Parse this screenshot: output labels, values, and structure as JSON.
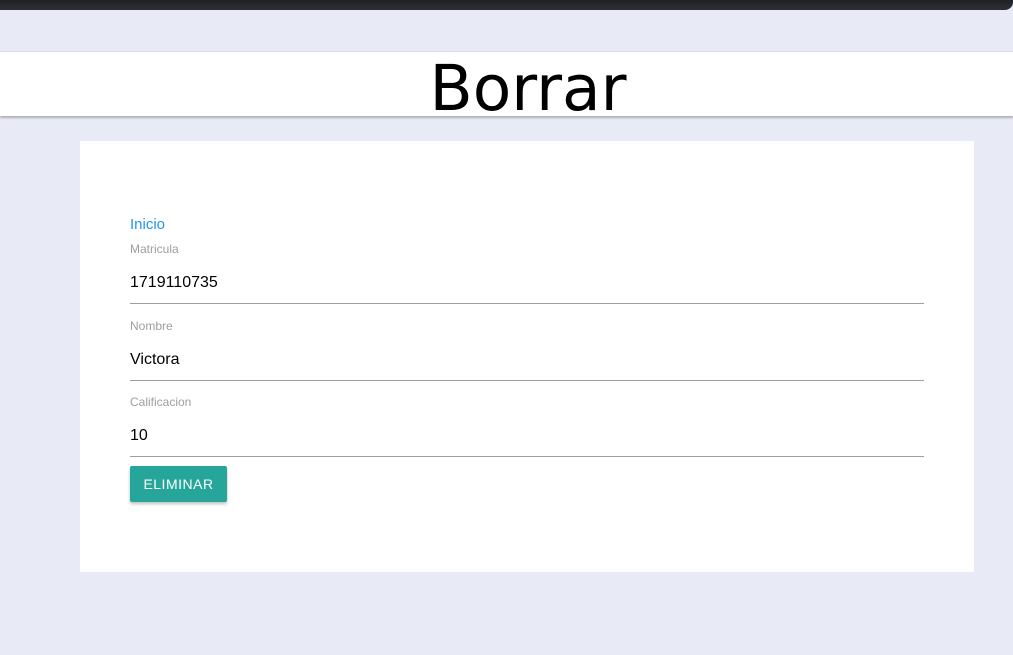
{
  "header": {
    "title": "Borrar"
  },
  "nav": {
    "inicio_label": "Inicio"
  },
  "form": {
    "fields": [
      {
        "label": "Matricula",
        "value": "1719110735"
      },
      {
        "label": "Nombre",
        "value": "Victora"
      },
      {
        "label": "Calificacion",
        "value": "10"
      }
    ],
    "submit_label": "ELIMINAR"
  },
  "colors": {
    "background": "#e8eaf6",
    "link": "#2196f3",
    "button": "#26a69a",
    "label": "#9e9e9e"
  }
}
